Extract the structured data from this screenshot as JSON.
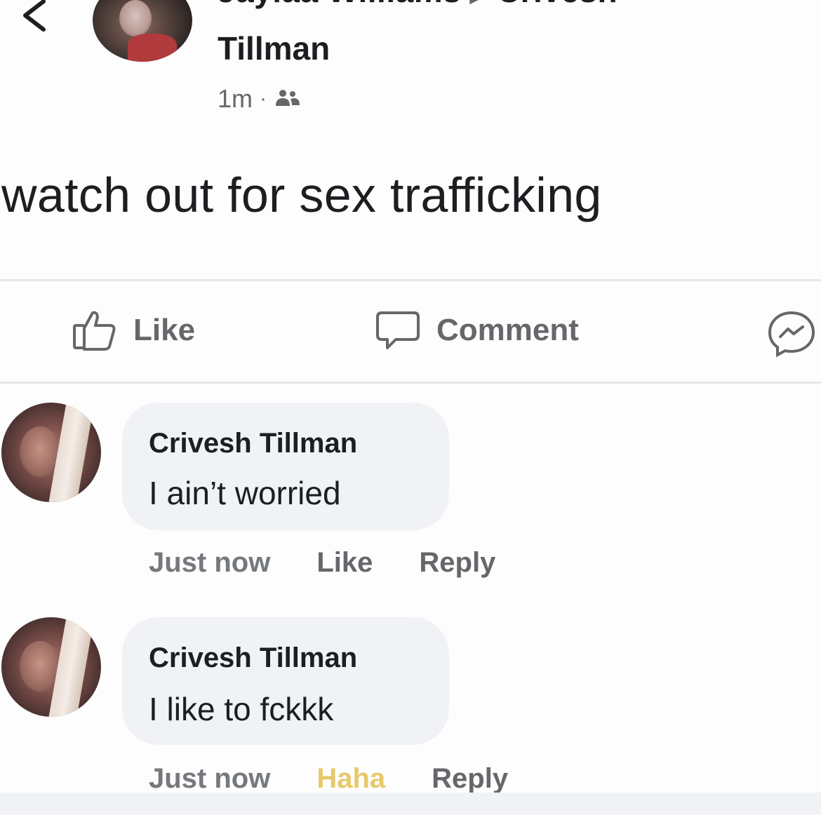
{
  "header": {
    "author_line1_left": "Jaylaa Williams",
    "author_line1_right": "Crivesh",
    "author_line2": "Tillman",
    "timestamp": "1m",
    "separator": "·",
    "audience_icon": "friends-icon"
  },
  "post": {
    "text": "watch out for sex trafficking"
  },
  "actions": {
    "like_label": "Like",
    "comment_label": "Comment",
    "share_icon": "messenger-icon"
  },
  "comments": [
    {
      "name": "Crivesh Tillman",
      "text": "I ain’t worried",
      "time": "Just now",
      "reaction_label": "Like",
      "reply_label": "Reply"
    },
    {
      "name": "Crivesh Tillman",
      "text": "I like to fckkk",
      "time": "Just now",
      "reaction_label": "Haha",
      "reply_label": "Reply"
    }
  ],
  "colors": {
    "text": "#1c1e21",
    "secondary": "#65676b",
    "bubble": "#f0f2f5",
    "haha": "#e7c96a"
  }
}
